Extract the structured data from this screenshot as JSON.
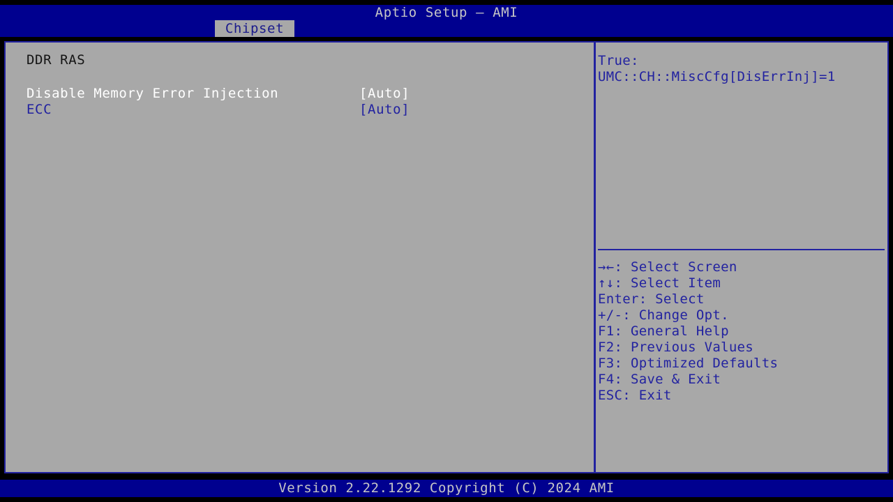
{
  "window": {
    "title": "Aptio Setup – AMI",
    "bg_color": "#00008f",
    "panel_color": "#a8a8a8",
    "accent_color": "#2222a0"
  },
  "tabs": [
    {
      "label": "Chipset",
      "active": true
    }
  ],
  "settings": {
    "section_heading": "DDR RAS",
    "items": [
      {
        "label": "Disable Memory Error Injection",
        "value": "[Auto]",
        "selected": true
      },
      {
        "label": "ECC",
        "value": "[Auto]",
        "selected": false
      }
    ]
  },
  "help": {
    "description_lines": [
      "True:",
      "UMC::CH::MiscCfg[DisErrInj]=1"
    ],
    "keys": [
      {
        "glyph": "→←",
        "text": ": Select Screen"
      },
      {
        "glyph": "↑↓",
        "text": ": Select Item"
      },
      {
        "glyph": "",
        "text": "Enter: Select"
      },
      {
        "glyph": "",
        "text": "+/-: Change Opt."
      },
      {
        "glyph": "",
        "text": "F1: General Help"
      },
      {
        "glyph": "",
        "text": "F2: Previous Values"
      },
      {
        "glyph": "",
        "text": "F3: Optimized Defaults"
      },
      {
        "glyph": "",
        "text": "F4: Save & Exit"
      },
      {
        "glyph": "",
        "text": "ESC: Exit"
      }
    ]
  },
  "footer": {
    "version_text": "Version 2.22.1292 Copyright (C) 2024 AMI"
  }
}
